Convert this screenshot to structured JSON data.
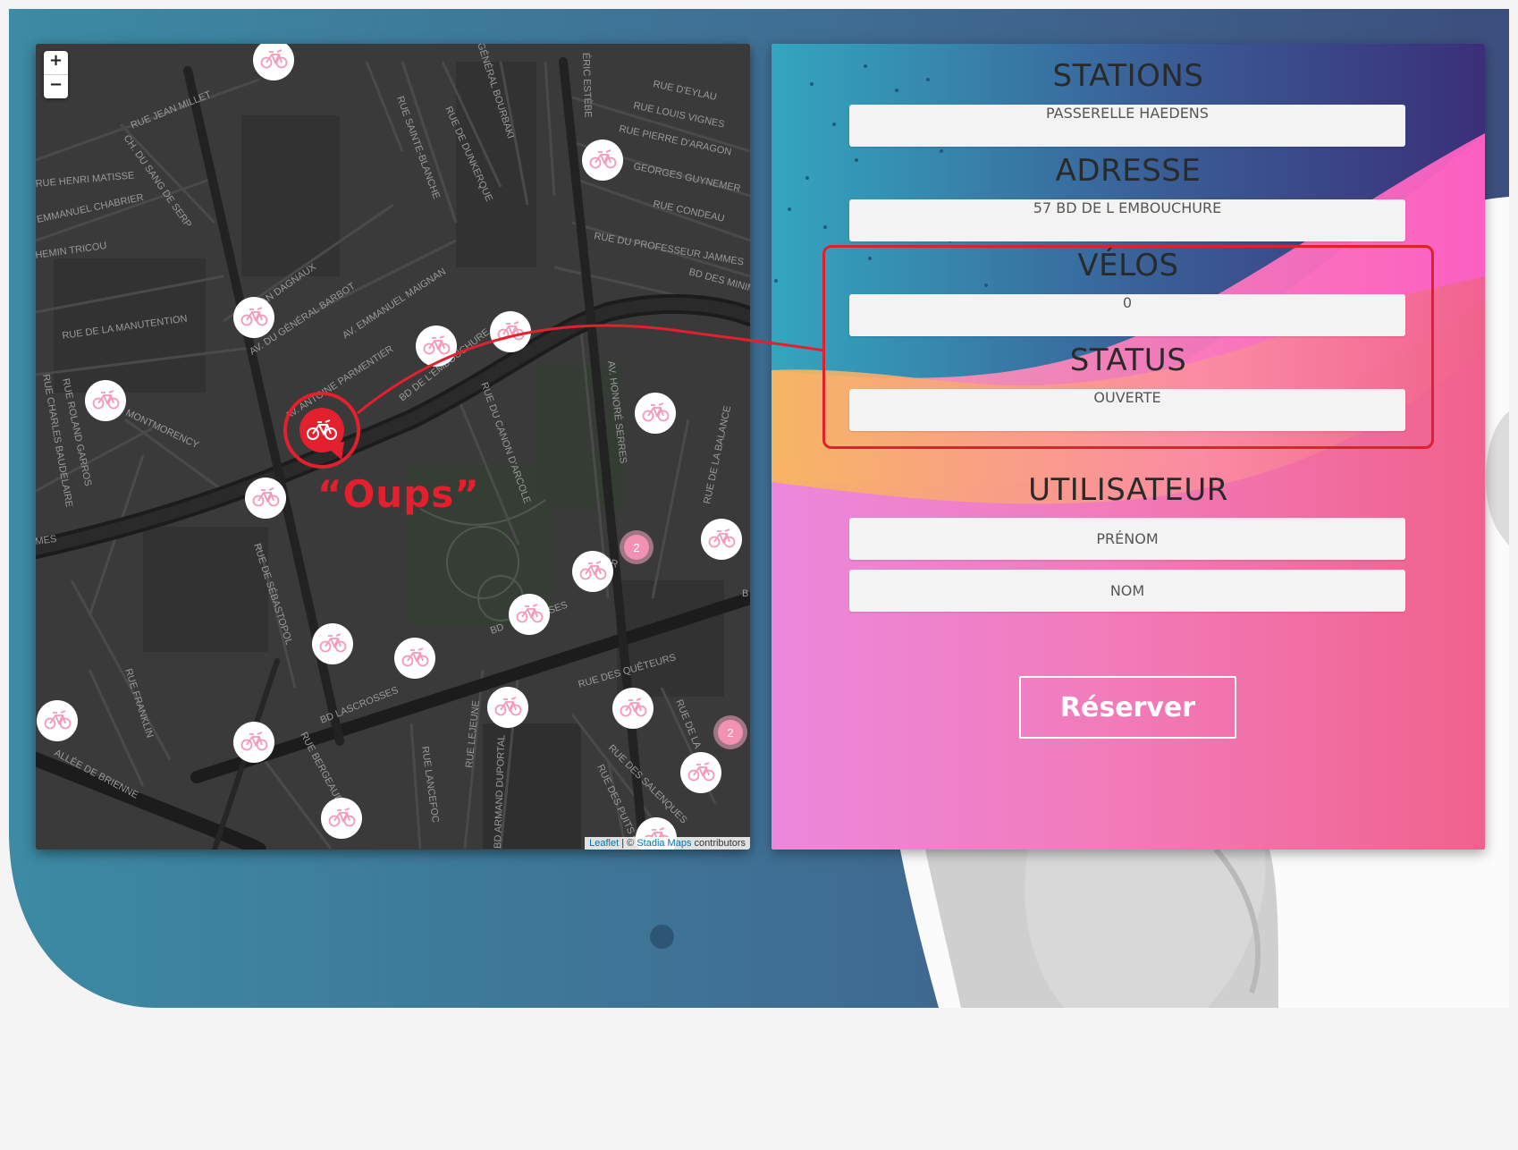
{
  "map": {
    "zoom_in": "+",
    "zoom_out": "−",
    "attribution": {
      "leaflet": "Leaflet",
      "separator": " | © ",
      "stadia": "Stadia Maps",
      "suffix": " contributors"
    },
    "cluster_counts": [
      "2",
      "2"
    ],
    "street_labels": [
      "RUE JEAN MILLET",
      "CH. DU SANG DE SERP",
      "RUE HENRI MATISSE",
      "EMMANUEL CHABRIER",
      "HEMIN TRICOU",
      "RUE DE LA MANUTENTION",
      "AV. DU GÉNÉRAL BARBOT",
      "JEAN DAGNAUX",
      "AV. EMMANUEL MAIGNAN",
      "AV. ANTOINE PARMENTIER",
      "BD DE L'EMBOUCHURE",
      "MONTMORENCY",
      "RUE ROLAND GARROS",
      "RUE CHARLES BAUDELAIRE",
      "RUE DE SÉBASTOPOL",
      "RUE DU CANON D'ARCOLE",
      "AV. HONORÉ SERRES",
      "RUE DE LA BALANCE",
      "BD DES MINIMES",
      "RUE D'EYLAU",
      "RUE LOUIS VIGNES",
      "RUE PIERRE D'ARAGON",
      "GEORGES GUYNEMER",
      "RUE CONDEAU",
      "RUE DU PROFESSEUR JAMMES",
      "RUE SAINTE-BLANCHE",
      "RUE DE DUNKERQUE",
      "GÉNÉRAL BOURBAKI",
      "BD LASCROSSES",
      "RUE DES QUÊTEURS",
      "RUE DES SALENQUES",
      "RUE DES PUITS CREUSÉS",
      "RUE LEJEUNE",
      "BD ARMAND DUPORTAL",
      "RUE LANCEFOC",
      "RUE BERGEAUD",
      "RUE FRANKLIN",
      "ALLÉE DE BRIENNE",
      "RUE DE LA",
      "ÉRIC ESTÈBE",
      "MES",
      "BD",
      "SSES",
      "TOR",
      "B"
    ]
  },
  "panel": {
    "station_label": "STATIONS",
    "station_value": "PASSERELLE HAEDENS",
    "address_label": "ADRESSE",
    "address_value": "57 BD DE L EMBOUCHURE",
    "bikes_label": "VÉLOS",
    "bikes_value": "0",
    "status_label": "STATUS",
    "status_value": "OUVERTE",
    "user_label": "UTILISATEUR",
    "firstname_placeholder": "PRÉNOM",
    "lastname_placeholder": "NOM",
    "reserve_button": "Réserver"
  },
  "annotation": {
    "text": "“Oups”",
    "color": "#e2202e"
  },
  "colors": {
    "brand_teal": "#3a8fa8",
    "brand_navy": "#3c4f7e",
    "panel_pink": "#f06fa0",
    "panel_orange": "#f7b26a",
    "marker_pink": "#f39ab8"
  }
}
